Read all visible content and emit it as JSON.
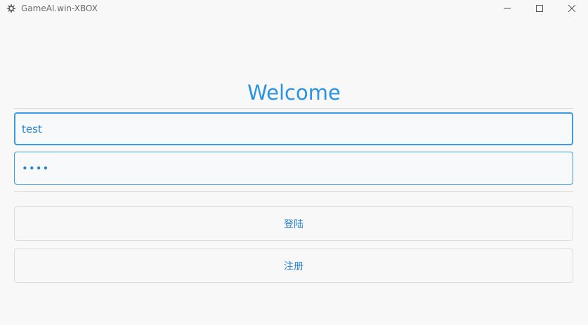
{
  "window": {
    "title": "GameAI.win-XBOX",
    "icon": "xbox-app-icon"
  },
  "login": {
    "heading": "Welcome",
    "username_value": "test",
    "password_value": "••••",
    "login_label": "登陆",
    "register_label": "注册"
  },
  "colors": {
    "accent": "#2b93e0",
    "field_border": "#3a9be6",
    "background": "#f8f8f8",
    "divider": "#dcdcdc"
  }
}
